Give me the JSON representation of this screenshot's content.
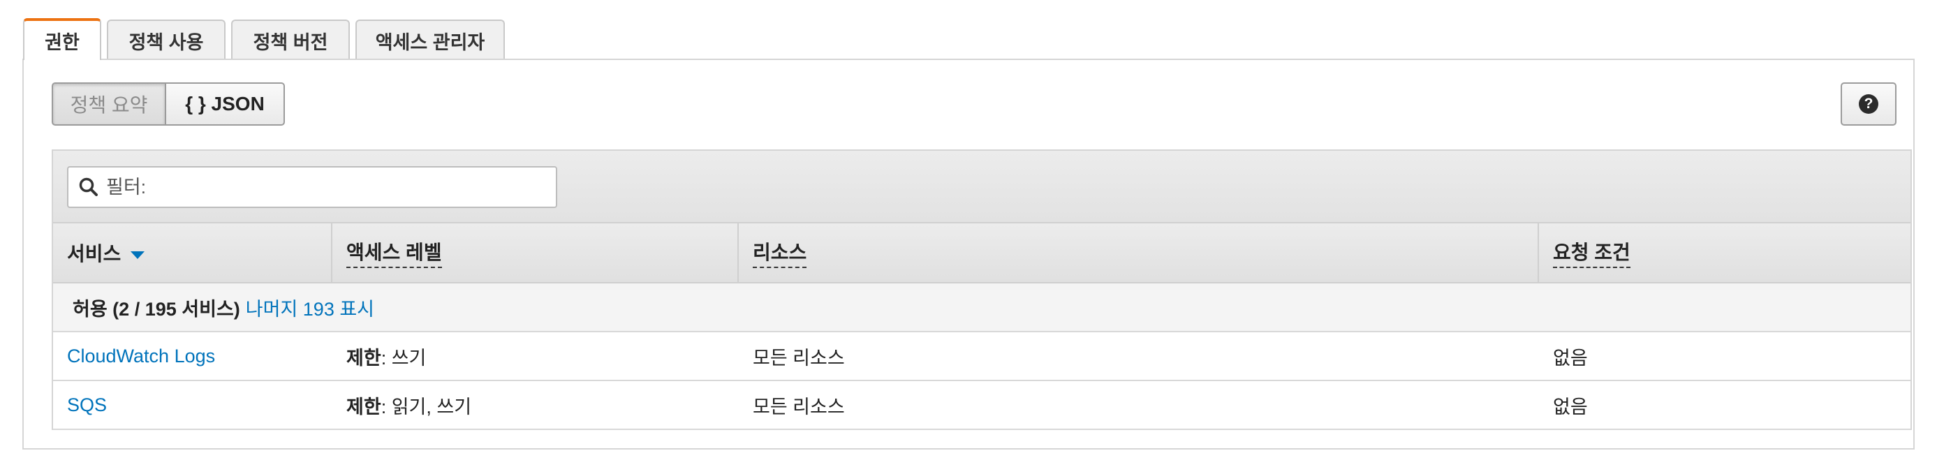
{
  "tabs": [
    {
      "label": "권한",
      "active": true
    },
    {
      "label": "정책 사용",
      "active": false
    },
    {
      "label": "정책 버전",
      "active": false
    },
    {
      "label": "액세스 관리자",
      "active": false
    }
  ],
  "view_toggle": {
    "summary_label": "정책 요약",
    "json_label": "{ } JSON",
    "selected": "정책 요약"
  },
  "help": {
    "glyph": "?",
    "icon": "help-icon"
  },
  "filter": {
    "placeholder": "필터:",
    "value": "",
    "icon": "search-icon"
  },
  "columns": [
    {
      "label": "서비스",
      "sorted": "desc"
    },
    {
      "label": "액세스 레벨"
    },
    {
      "label": "리소스"
    },
    {
      "label": "요청 조건"
    }
  ],
  "group": {
    "label": "허용 (2 / 195 서비스)",
    "show_rest_link": "나머지 193 표시"
  },
  "rows": [
    {
      "service": "CloudWatch Logs",
      "access_prefix": "제한",
      "access_rest": ": 쓰기",
      "resource": "모든 리소스",
      "condition": "없음"
    },
    {
      "service": "SQS",
      "access_prefix": "제한",
      "access_rest": ": 읽기, 쓰기",
      "resource": "모든 리소스",
      "condition": "없음"
    }
  ],
  "colors": {
    "active_tab_accent": "#ec7211",
    "link": "#0073bb"
  }
}
